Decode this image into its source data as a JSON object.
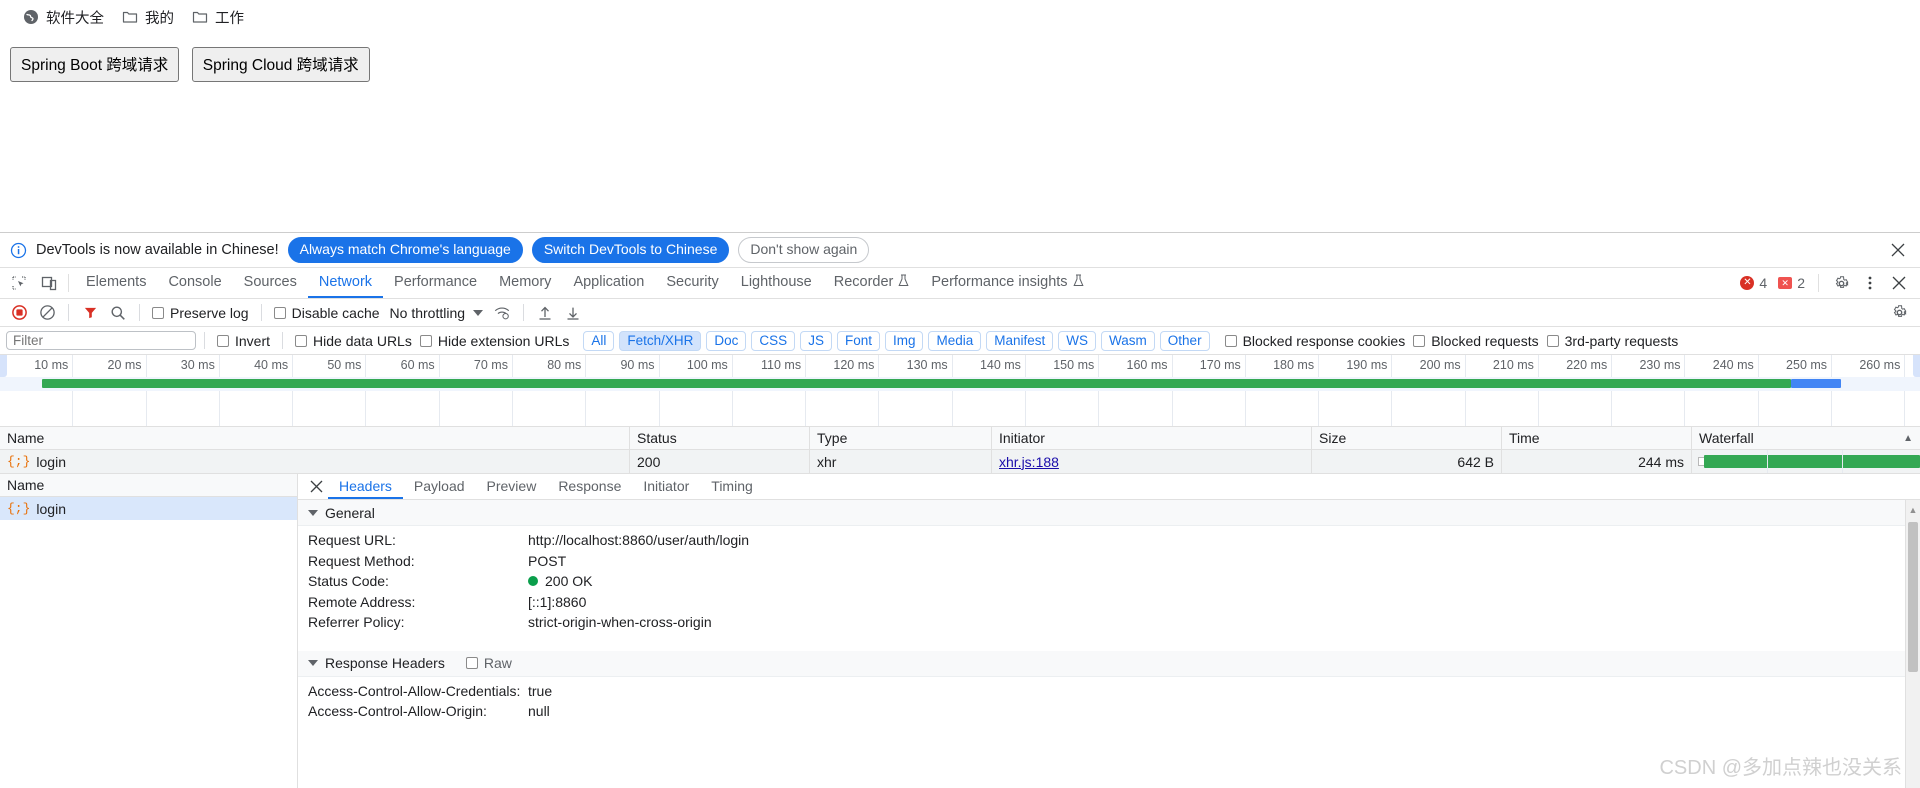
{
  "bookmarks": [
    {
      "label": "软件大全",
      "icon": "globe-icon"
    },
    {
      "label": "我的",
      "icon": "folder-icon"
    },
    {
      "label": "工作",
      "icon": "folder-icon"
    }
  ],
  "page": {
    "buttons": [
      {
        "label": "Spring Boot 跨域请求"
      },
      {
        "label": "Spring Cloud 跨域请求"
      }
    ]
  },
  "infobar": {
    "icon": "info-icon",
    "message": "DevTools is now available in Chinese!",
    "primary_action": "Always match Chrome's language",
    "secondary_action": "Switch DevTools to Chinese",
    "dismiss_action": "Don't show again",
    "close_icon": "close-icon"
  },
  "devtools": {
    "tabs": [
      {
        "label": "Elements",
        "active": false
      },
      {
        "label": "Console",
        "active": false
      },
      {
        "label": "Sources",
        "active": false
      },
      {
        "label": "Network",
        "active": true
      },
      {
        "label": "Performance",
        "active": false
      },
      {
        "label": "Memory",
        "active": false
      },
      {
        "label": "Application",
        "active": false
      },
      {
        "label": "Security",
        "active": false
      },
      {
        "label": "Lighthouse",
        "active": false
      },
      {
        "label": "Recorder",
        "active": false,
        "badge": "experiment-flask-icon"
      },
      {
        "label": "Performance insights",
        "active": false,
        "badge": "experiment-flask-icon"
      }
    ],
    "error_count": "4",
    "warning_count": "2",
    "settings_icon": "gear-icon",
    "more_icon": "kebab-menu-icon",
    "close_icon": "close-icon",
    "inspect_icon": "inspect-element-icon",
    "device_icon": "device-toolbar-icon"
  },
  "network_toolbar": {
    "record_icon": "record-stop-icon",
    "clear_icon": "clear-icon",
    "filter_icon": "filter-funnel-icon",
    "search_icon": "search-icon",
    "preserve_log": "Preserve log",
    "disable_cache": "Disable cache",
    "throttling": "No throttling",
    "wifi_icon": "network-conditions-icon",
    "import_icon": "import-har-icon",
    "export_icon": "export-har-icon",
    "settings_icon": "gear-icon"
  },
  "filter_bar": {
    "placeholder": "Filter",
    "invert": "Invert",
    "hide_data_urls": "Hide data URLs",
    "hide_extension_urls": "Hide extension URLs",
    "types": [
      {
        "label": "All",
        "active": false
      },
      {
        "label": "Fetch/XHR",
        "active": true
      },
      {
        "label": "Doc",
        "active": false
      },
      {
        "label": "CSS",
        "active": false
      },
      {
        "label": "JS",
        "active": false
      },
      {
        "label": "Font",
        "active": false
      },
      {
        "label": "Img",
        "active": false
      },
      {
        "label": "Media",
        "active": false
      },
      {
        "label": "Manifest",
        "active": false
      },
      {
        "label": "WS",
        "active": false
      },
      {
        "label": "Wasm",
        "active": false
      },
      {
        "label": "Other",
        "active": false
      }
    ],
    "blocked_response_cookies": "Blocked response cookies",
    "blocked_requests": "Blocked requests",
    "third_party_requests": "3rd-party requests"
  },
  "overview": {
    "ticks": [
      "10 ms",
      "20 ms",
      "30 ms",
      "40 ms",
      "50 ms",
      "60 ms",
      "70 ms",
      "80 ms",
      "90 ms",
      "100 ms",
      "110 ms",
      "120 ms",
      "130 ms",
      "140 ms",
      "150 ms",
      "160 ms",
      "170 ms",
      "180 ms",
      "190 ms",
      "200 ms",
      "210 ms",
      "220 ms",
      "230 ms",
      "240 ms",
      "250 ms",
      "260 ms"
    ],
    "bar_green_pct": "2.2,91.1",
    "bar_blue_pct": "93.3,2.6"
  },
  "request_table": {
    "columns": [
      "Name",
      "Status",
      "Type",
      "Initiator",
      "Size",
      "Time",
      "Waterfall"
    ],
    "sort_caret": "▲",
    "rows": [
      {
        "name": "login",
        "icon": "xhr-json-icon",
        "status": "200",
        "type": "xhr",
        "initiator": "xhr.js:188",
        "size": "642 B",
        "time": "244 ms"
      }
    ]
  },
  "left_list": {
    "header": "Name",
    "items": [
      {
        "label": "login",
        "icon": "xhr-json-icon",
        "selected": true
      }
    ]
  },
  "detail": {
    "close_icon": "close-icon",
    "tabs": [
      {
        "label": "Headers",
        "active": true
      },
      {
        "label": "Payload",
        "active": false
      },
      {
        "label": "Preview",
        "active": false
      },
      {
        "label": "Response",
        "active": false
      },
      {
        "label": "Initiator",
        "active": false
      },
      {
        "label": "Timing",
        "active": false
      }
    ],
    "general": {
      "title": "General",
      "rows": [
        {
          "key": "Request URL:",
          "value": "http://localhost:8860/user/auth/login"
        },
        {
          "key": "Request Method:",
          "value": "POST"
        },
        {
          "key": "Status Code:",
          "value": "200 OK",
          "status_dot": "#0a9e4b"
        },
        {
          "key": "Remote Address:",
          "value": "[::1]:8860"
        },
        {
          "key": "Referrer Policy:",
          "value": "strict-origin-when-cross-origin"
        }
      ]
    },
    "response_headers": {
      "title": "Response Headers",
      "raw_label": "Raw",
      "rows": [
        {
          "key": "Access-Control-Allow-Credentials:",
          "value": "true"
        },
        {
          "key": "Access-Control-Allow-Origin:",
          "value": "null"
        }
      ]
    }
  },
  "watermark": "CSDN @多加点辣也没关系"
}
